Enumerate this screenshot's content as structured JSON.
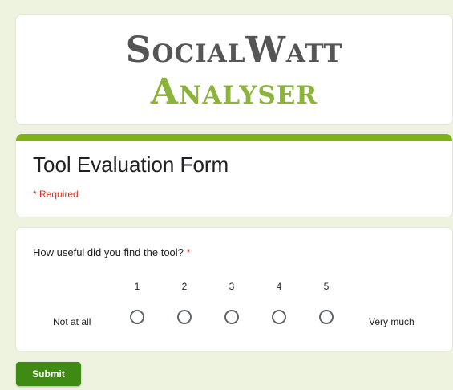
{
  "banner": {
    "line1": "SocialWatt",
    "line2": "Analyser"
  },
  "form": {
    "title": "Tool Evaluation Form",
    "required_note": "* Required",
    "accent_color": "#7fb217"
  },
  "question": {
    "text": "How useful did you find the tool?",
    "required_marker": "*",
    "scale": [
      "1",
      "2",
      "3",
      "4",
      "5"
    ],
    "low_label": "Not at all",
    "high_label": "Very much",
    "selected": null
  },
  "actions": {
    "submit_label": "Submit"
  }
}
